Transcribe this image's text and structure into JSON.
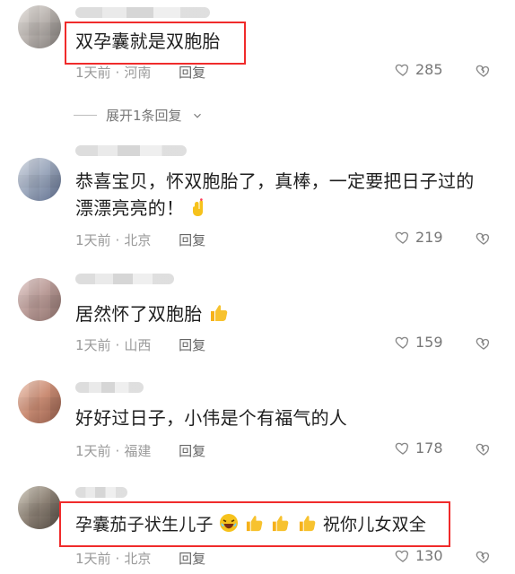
{
  "comments": [
    {
      "text": "双孕囊就是双胞胎",
      "time": "1天前",
      "location": "河南",
      "reply_label": "回复",
      "likes": "285"
    },
    {
      "text": "恭喜宝贝，怀双胞胎了，真棒，一定要把日子过的漂漂亮亮的！",
      "time": "1天前",
      "location": "北京",
      "reply_label": "回复",
      "likes": "219"
    },
    {
      "text": "居然怀了双胞胎",
      "time": "1天前",
      "location": "山西",
      "reply_label": "回复",
      "likes": "159"
    },
    {
      "text": "好好过日子，小伟是个有福气的人",
      "time": "1天前",
      "location": "福建",
      "reply_label": "回复",
      "likes": "178"
    },
    {
      "text_before": "孕囊茄子状生儿子",
      "text_after": "祝你儿女双全",
      "time": "1天前",
      "location": "北京",
      "reply_label": "回复",
      "likes": "130"
    }
  ],
  "expand_replies": "展开1条回复",
  "icons": {
    "like": "heart-outline-icon",
    "dislike": "broken-heart-icon",
    "expand": "chevron-down-icon"
  },
  "colors": {
    "highlight": "#f02b2b",
    "emoji_yellow": "#f6c21c"
  }
}
